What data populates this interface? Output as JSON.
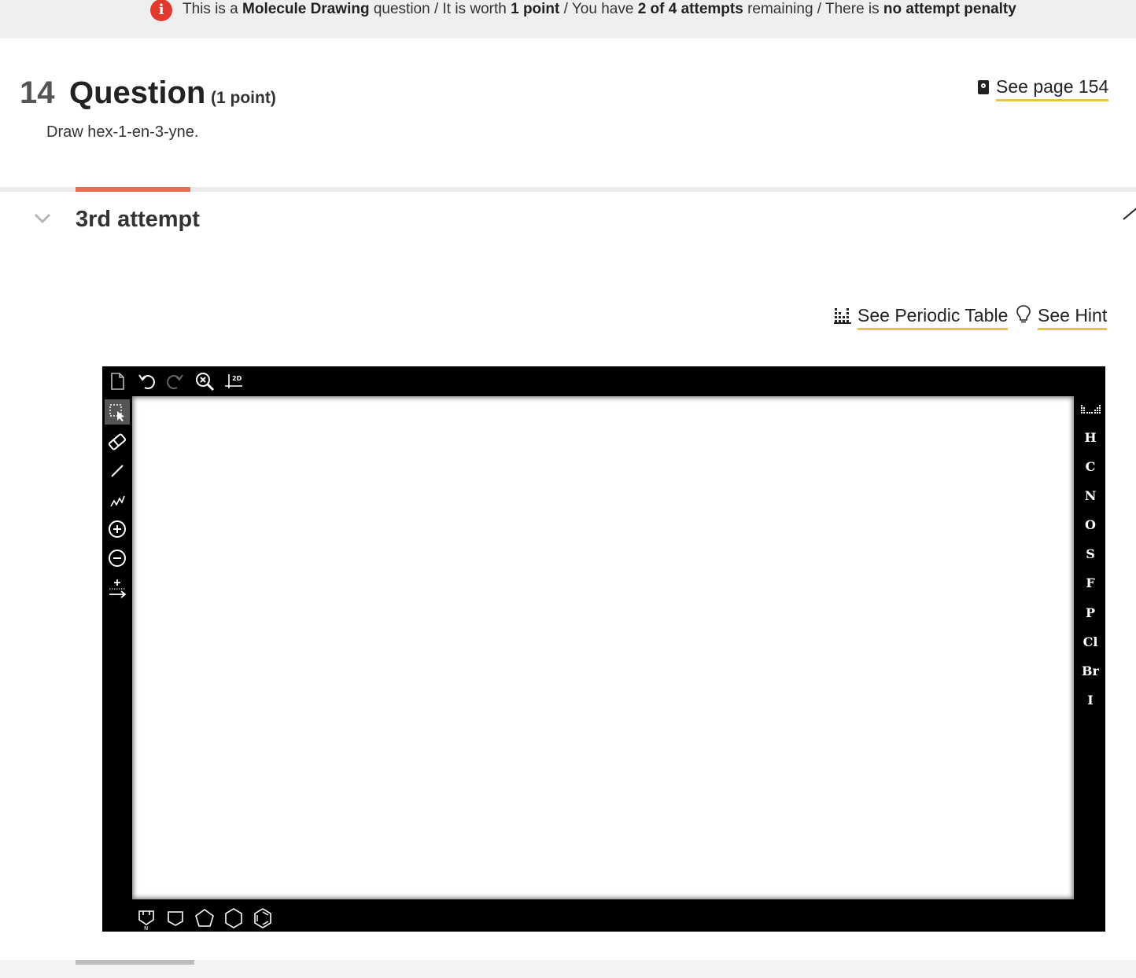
{
  "banner": {
    "p1": "This is a ",
    "question_type": "Molecule Drawing",
    "p2": " question / It is worth ",
    "points": "1 point",
    "p3": " / You have ",
    "attempts": "2 of 4 attempts",
    "p4": " remaining / There is ",
    "penalty": "no attempt penalty",
    "icon": "info-icon",
    "icon_glyph": "i"
  },
  "question": {
    "number": "14",
    "title": "Question",
    "points": "(1 point)",
    "prompt": "Draw hex-1-en-3-yne.",
    "see_page": "See page 154"
  },
  "attempt": {
    "title": "3rd attempt",
    "see_periodic_table": "See Periodic Table",
    "see_hint": "See Hint"
  },
  "editor": {
    "top_tools": [
      "new-document",
      "undo",
      "redo",
      "zoom-reset",
      "2d-clean"
    ],
    "clean_label": "2D",
    "left_tools": [
      "select",
      "erase",
      "single-bond",
      "chain",
      "increase-charge",
      "decrease-charge",
      "reaction-arrow"
    ],
    "elements": [
      "H",
      "C",
      "N",
      "O",
      "S",
      "F",
      "P",
      "Cl",
      "Br",
      "I"
    ],
    "rings": [
      "template",
      "cyclobutane",
      "cyclopentane",
      "cyclohexane",
      "benzene"
    ],
    "accent_color": "#e4704f",
    "link_underline": "#e8c34a",
    "info_color": "#e03a2e"
  }
}
